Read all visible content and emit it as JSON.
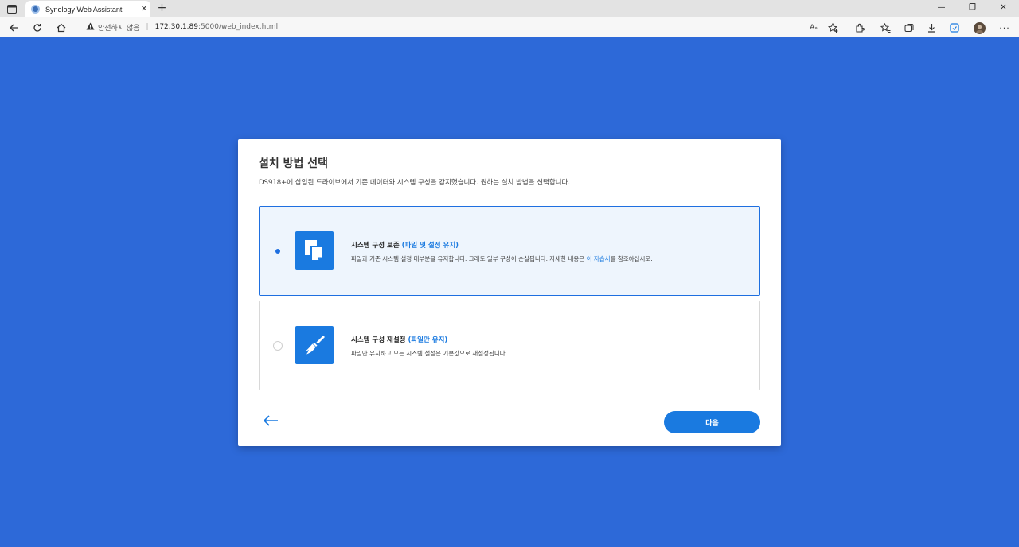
{
  "browser": {
    "tab_title": "Synology Web Assistant",
    "new_tab_glyph": "+",
    "address": {
      "security_label": "안전하지 않음",
      "host": "172.30.1.89",
      "path": ":5000/web_index.html"
    },
    "window_controls": {
      "minimize": "—",
      "restore": "❐",
      "close": "✕"
    }
  },
  "dialog": {
    "title": "설치 방법 선택",
    "description": "DS918+에 삽입된 드라이브에서 기존 데이터와 시스템 구성을 감지했습니다. 원하는 설치 방법을 선택합니다.",
    "options": [
      {
        "title": "시스템 구성 보존",
        "tag": "(파일 및 설정 유지)",
        "desc_before": "파일과 기존 시스템 설정 대부분을 유지합니다. 그래도 일부 구성이 손실됩니다. 자세한 내용은 ",
        "link": "이 자습서",
        "desc_after": "를 참조하십시오.",
        "selected": true,
        "icon": "copy-files-icon"
      },
      {
        "title": "시스템 구성 재설정",
        "tag": "(파일만 유지)",
        "description": "파일만 유지하고 모든 시스템 설정은 기본값으로 재설정됩니다.",
        "selected": false,
        "icon": "broom-icon"
      }
    ],
    "back_icon": "arrow-left-icon",
    "next_label": "다음"
  },
  "colors": {
    "background": "#2d69d8",
    "accent": "#1a7ae0",
    "selected_bg": "#eef5fd"
  }
}
